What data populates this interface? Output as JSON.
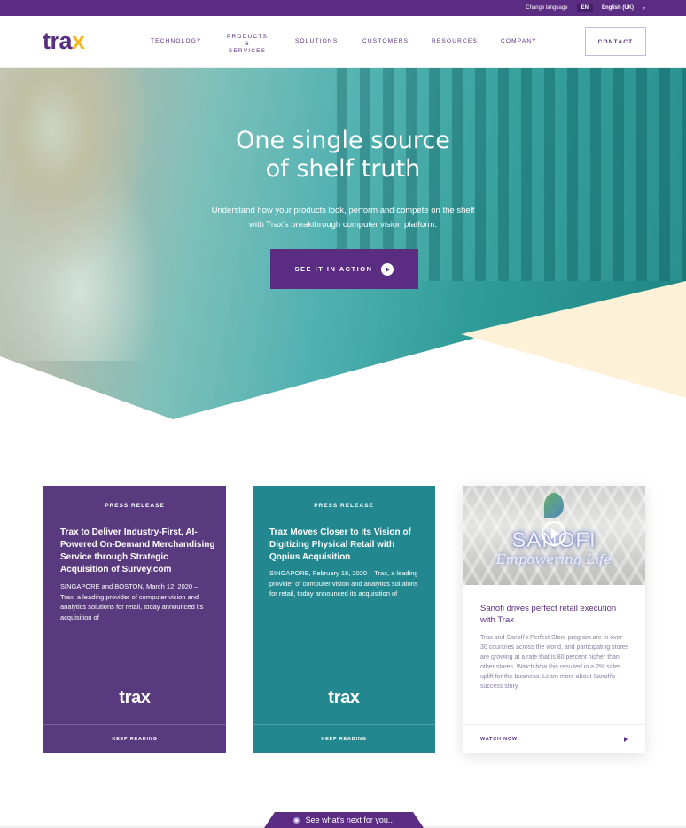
{
  "topbar": {
    "change_language_label": "Change language",
    "lang_code": "EN",
    "lang_selected": "English (UK)",
    "caret_icon": "▾"
  },
  "header": {
    "logo_text_main": "tra",
    "logo_text_x": "x",
    "nav": [
      {
        "label": "TECHNOLOGY"
      },
      {
        "label": "PRODUCTS\n& SERVICES"
      },
      {
        "label": "SOLUTIONS"
      },
      {
        "label": "CUSTOMERS"
      },
      {
        "label": "RESOURCES"
      },
      {
        "label": "COMPANY"
      }
    ],
    "contact_label": "CONTACT"
  },
  "hero": {
    "title_line1": "One single source",
    "title_line2": "of shelf truth",
    "subtitle_line1": "Understand how your products look, perform and compete on the shelf",
    "subtitle_line2": "with Trax's breakthrough computer vision platform.",
    "cta_label": "SEE IT IN ACTION"
  },
  "cards": [
    {
      "kicker": "PRESS RELEASE",
      "title": "Trax to Deliver Industry-First, AI-Powered On-Demand Merchandising Service through Strategic Acquisition of Survey.com",
      "body": "SINGAPORE and BOSTON, March 12, 2020 – Trax, a leading provider of computer vision and analytics solutions for retail, today announced its acquisition of",
      "logo": "trax",
      "footer": "KEEP READING"
    },
    {
      "kicker": "PRESS RELEASE",
      "title": "Trax Moves Closer to its Vision of Digitizing Physical Retail with Qopius Acquisition",
      "body": "SINGAPORE, February 18, 2020 – Trax, a leading provider of computer vision and analytics solutions for retail, today announced its acquisition of",
      "logo": "trax",
      "footer": "KEEP READING"
    },
    {
      "thumb_brand": "SANOFI",
      "thumb_tagline": "Empowering Life",
      "title": "Sanofi drives perfect retail execution with Trax",
      "body": "Trax and Sanofi's Perfect Store program are in over 30 countries across the world, and participating stores are growing at a rate that is 80 percent higher than other stores. Watch how this resulted in a 2% sales uplift for the business. Learn more about Sanofi's success story.",
      "footer": "WATCH NOW"
    }
  ],
  "next_tab": {
    "label": "See what's next for you..."
  },
  "colors": {
    "brand_purple": "#5a2d82",
    "brand_yellow": "#f4b71f",
    "teal": "#22878f"
  }
}
